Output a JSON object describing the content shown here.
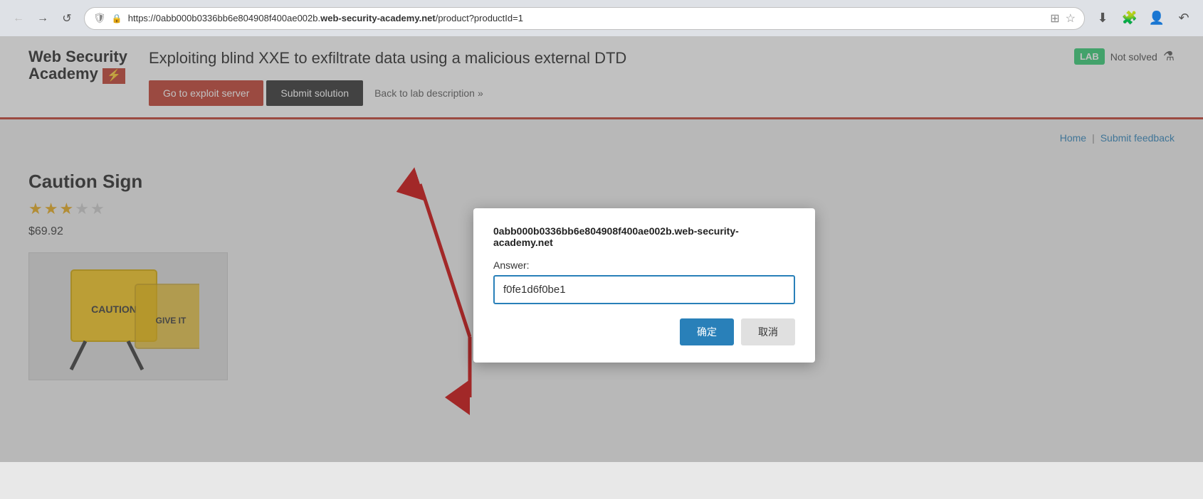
{
  "browser": {
    "url_prefix": "https://0abb000b0336bb6e804908f400ae002b.",
    "url_domain": "web-security-academy.net",
    "url_path": "/product?productId=1",
    "back_label": "←",
    "forward_label": "→",
    "refresh_label": "↺"
  },
  "header": {
    "logo_line1": "Web Security",
    "logo_line2": "Academy",
    "logo_icon": "⚡",
    "lab_title": "Exploiting blind XXE to exfiltrate data using a malicious external DTD",
    "lab_badge": "LAB",
    "lab_status": "Not solved",
    "btn_exploit": "Go to exploit server",
    "btn_submit_solution": "Submit solution",
    "btn_back": "Back to lab description",
    "btn_back_arrow": "»"
  },
  "nav": {
    "home": "Home",
    "separator": "|",
    "submit_feedback": "Submit feedback"
  },
  "product": {
    "name": "Caution Sign",
    "price": "$69.92",
    "stars_filled": 3,
    "stars_total": 5
  },
  "dialog": {
    "origin": "0abb000b0336bb6e804908f400ae002b.web-security-academy.net",
    "origin_prefix": "b0336bb6e",
    "label": "Answer:",
    "input_value": "f0fe1d6f0be1",
    "btn_confirm": "确定",
    "btn_cancel": "取消"
  }
}
